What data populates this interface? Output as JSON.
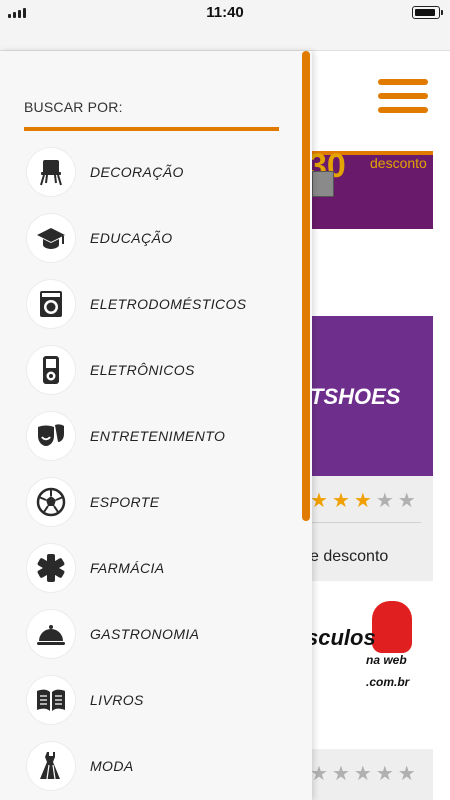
{
  "status_bar": {
    "time": "11:40",
    "battery_level": 0.95
  },
  "drawer": {
    "heading": "BUSCAR POR:",
    "categories": [
      {
        "label": "DECORAÇÃO",
        "icon": "chair-icon"
      },
      {
        "label": "EDUCAÇÃO",
        "icon": "graduation-cap-icon"
      },
      {
        "label": "ELETRODOMÉSTICOS",
        "icon": "washing-machine-icon"
      },
      {
        "label": "ELETRÔNICOS",
        "icon": "music-player-icon"
      },
      {
        "label": "ENTRETENIMENTO",
        "icon": "theater-masks-icon"
      },
      {
        "label": "ESPORTE",
        "icon": "soccer-ball-icon"
      },
      {
        "label": "FARMÁCIA",
        "icon": "medical-asterisk-icon"
      },
      {
        "label": "GASTRONOMIA",
        "icon": "food-cloche-icon"
      },
      {
        "label": "LIVROS",
        "icon": "open-book-icon"
      },
      {
        "label": "MODA",
        "icon": "dress-icon"
      }
    ]
  },
  "background": {
    "banner1": {
      "number": "30",
      "text": "desconto"
    },
    "card1": {
      "brand": "TSHOES",
      "rating": 3,
      "max_rating": 5,
      "description": "e desconto"
    },
    "card2": {
      "logo_main": "sculos",
      "logo_sub": "na web",
      "logo_domain": ".com.br",
      "rating": 0,
      "max_rating": 5
    }
  },
  "colors": {
    "accent": "#e07b00",
    "purple": "#6e2f8c",
    "star_filled": "#f0a000",
    "star_empty": "#b0b0b0"
  }
}
